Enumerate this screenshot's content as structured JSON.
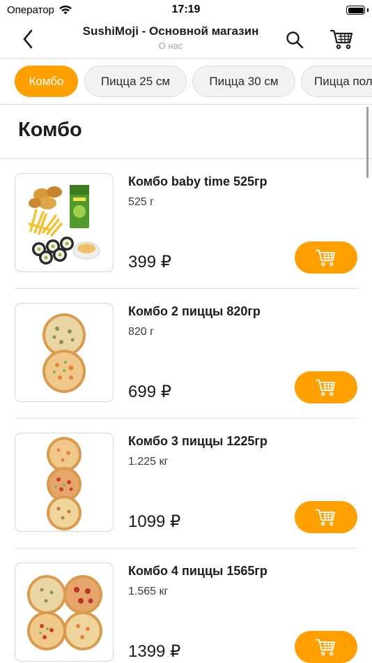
{
  "status_bar": {
    "carrier": "Оператор",
    "time": "17:19",
    "icons": [
      "wifi-icon",
      "battery-icon"
    ]
  },
  "header": {
    "title": "SushiMoji - Основной магазин",
    "subtitle": "О нас",
    "icons": [
      "back-chevron-icon",
      "search-icon",
      "cart-icon"
    ]
  },
  "categories": [
    {
      "label": "Комбо",
      "active": true
    },
    {
      "label": "Пицца 25 см",
      "active": false
    },
    {
      "label": "Пицца 30 см",
      "active": false
    },
    {
      "label": "Пицца пол",
      "active": false
    }
  ],
  "section": {
    "title": "Комбо"
  },
  "products": [
    {
      "name": "Комбо baby time 525гр",
      "weight": "525 г",
      "price": "399 ₽",
      "image": "nuggets-fries-rolls-juice"
    },
    {
      "name": "Комбо 2 пиццы 820гр",
      "weight": "820 г",
      "price": "699 ₽",
      "image": "two-pizzas"
    },
    {
      "name": "Комбо 3 пиццы 1225гр",
      "weight": "1.225 кг",
      "price": "1099 ₽",
      "image": "three-pizzas"
    },
    {
      "name": "Комбо 4 пиццы 1565гр",
      "weight": "1.565 кг",
      "price": "1399 ₽",
      "image": "four-pizzas"
    }
  ],
  "colors": {
    "accent": "#ffa000",
    "text": "#1c1c1e",
    "muted": "#a3a3a8",
    "divider": "#dcdcdc"
  }
}
